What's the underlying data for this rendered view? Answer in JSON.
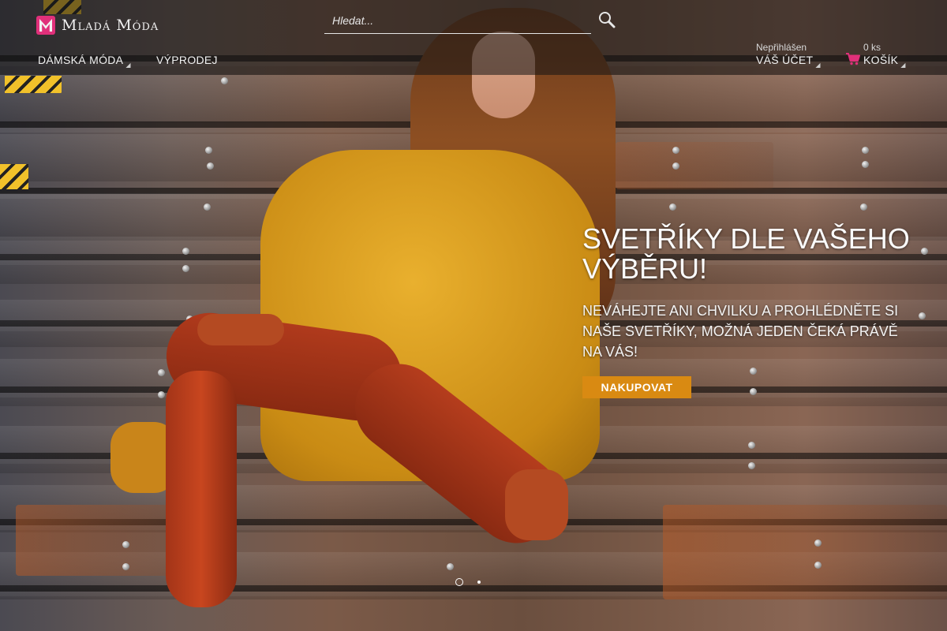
{
  "header": {
    "logo_text": "Mladá Móda",
    "search": {
      "placeholder": "Hledat..."
    },
    "nav": [
      {
        "label": "DÁMSKÁ MÓDA",
        "has_dropdown": true
      },
      {
        "label": "VÝPRODEJ",
        "has_dropdown": false
      }
    ],
    "account": {
      "status": "Nepřihlášen",
      "label": "VÁŠ ÚČET"
    },
    "cart": {
      "count": "0 ks",
      "label": "KOŠÍK"
    }
  },
  "hero": {
    "title": "SVETŘÍKY DLE VAŠEHO VÝBĚRU!",
    "subtitle": "NEVÁHEJTE ANI CHVILKU A PROHLÉDNĚTE SI NAŠE SVETŘÍKY, MOŽNÁ JEDEN ČEKÁ PRÁVĚ NA VÁS!",
    "cta_label": "NAKUPOVAT"
  },
  "carousel": {
    "slides": 2,
    "active_index": 0
  },
  "colors": {
    "accent": "#d98a12",
    "logo_pink": "#e0307a",
    "cart_pink": "#e0307a",
    "header_overlay": "rgba(20,20,20,0.55)"
  },
  "icons": {
    "logo": "logo-mark-icon",
    "search": "search-icon",
    "cart": "cart-icon",
    "caret": "caret-down-icon"
  }
}
